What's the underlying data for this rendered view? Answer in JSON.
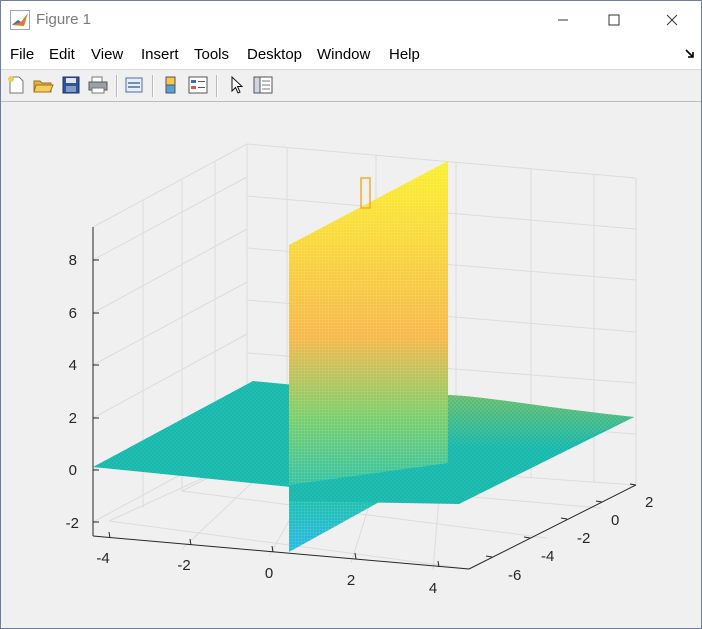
{
  "window": {
    "title": "Figure 1"
  },
  "menu": [
    "File",
    "Edit",
    "View",
    "Insert",
    "Tools",
    "Desktop",
    "Window",
    "Help"
  ],
  "toolbar_icons": [
    "new-figure-icon",
    "open-file-icon",
    "save-icon",
    "print-icon",
    "link-plot-icon",
    "colorbar-icon",
    "legend-icon",
    "edit-plot-arrow-icon",
    "property-inspector-icon"
  ],
  "colors": {
    "surface_base": "#1fbfb3",
    "surface_low": "#29a8dd",
    "surface_high": "#f9e92e",
    "surface_mid": "#f7b84a",
    "title_text": "#7a7a7a"
  },
  "chart_data": {
    "type": "surface",
    "title": "",
    "grid": true,
    "zlim": [
      -2.5,
      9
    ],
    "z_ticks": [
      "-2",
      "0",
      "2",
      "4",
      "6",
      "8"
    ],
    "x_ticks": [
      "-4",
      "-2",
      "0",
      "2",
      "4"
    ],
    "y_ticks": [
      "-6",
      "-4",
      "-2",
      "0",
      "2"
    ],
    "features": {
      "base_plane_z": 0,
      "vertical_sheet_range": [
        -2.5,
        8.5
      ],
      "ridge_peak": 2
    }
  }
}
